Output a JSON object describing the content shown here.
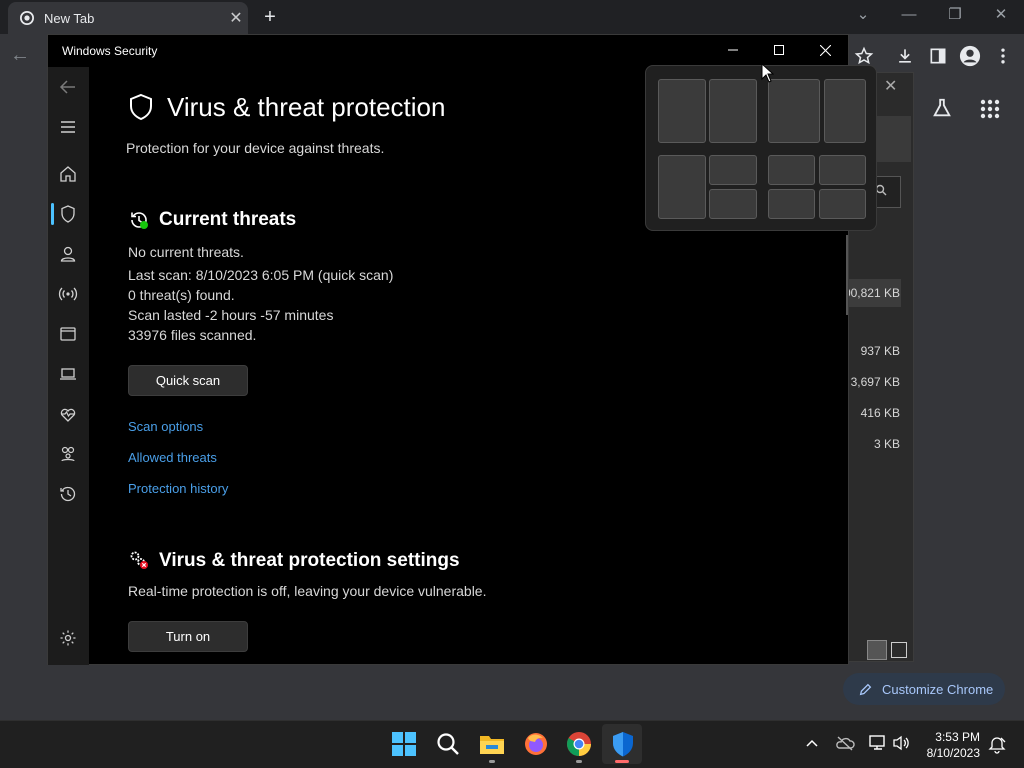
{
  "chrome": {
    "tab_title": "New Tab",
    "customize_label": "Customize Chrome",
    "panel_sizes": [
      "00,821 KB",
      "937 KB",
      "3,697 KB",
      "416 KB",
      "3 KB"
    ]
  },
  "window": {
    "title": "Windows Security"
  },
  "page": {
    "title": "Virus & threat protection",
    "subtitle": "Protection for your device against threats."
  },
  "current_threats": {
    "title": "Current threats",
    "lines": [
      "No current threats.",
      "Last scan: 8/10/2023 6:05 PM (quick scan)",
      "0 threat(s) found.",
      "Scan lasted -2 hours -57 minutes",
      "33976 files scanned."
    ],
    "quick_scan_label": "Quick scan",
    "links": [
      "Scan options",
      "Allowed threats",
      "Protection history"
    ]
  },
  "settings_section": {
    "title": "Virus & threat protection settings",
    "description": "Real-time protection is off, leaving your device vulnerable.",
    "turn_on_label": "Turn on"
  },
  "taskbar": {
    "time": "3:53 PM",
    "date": "8/10/2023"
  },
  "colors": {
    "accent_link": "#4a9fe8",
    "nav_active": "#4cc2ff",
    "defender_blue": "#0a66d0"
  }
}
